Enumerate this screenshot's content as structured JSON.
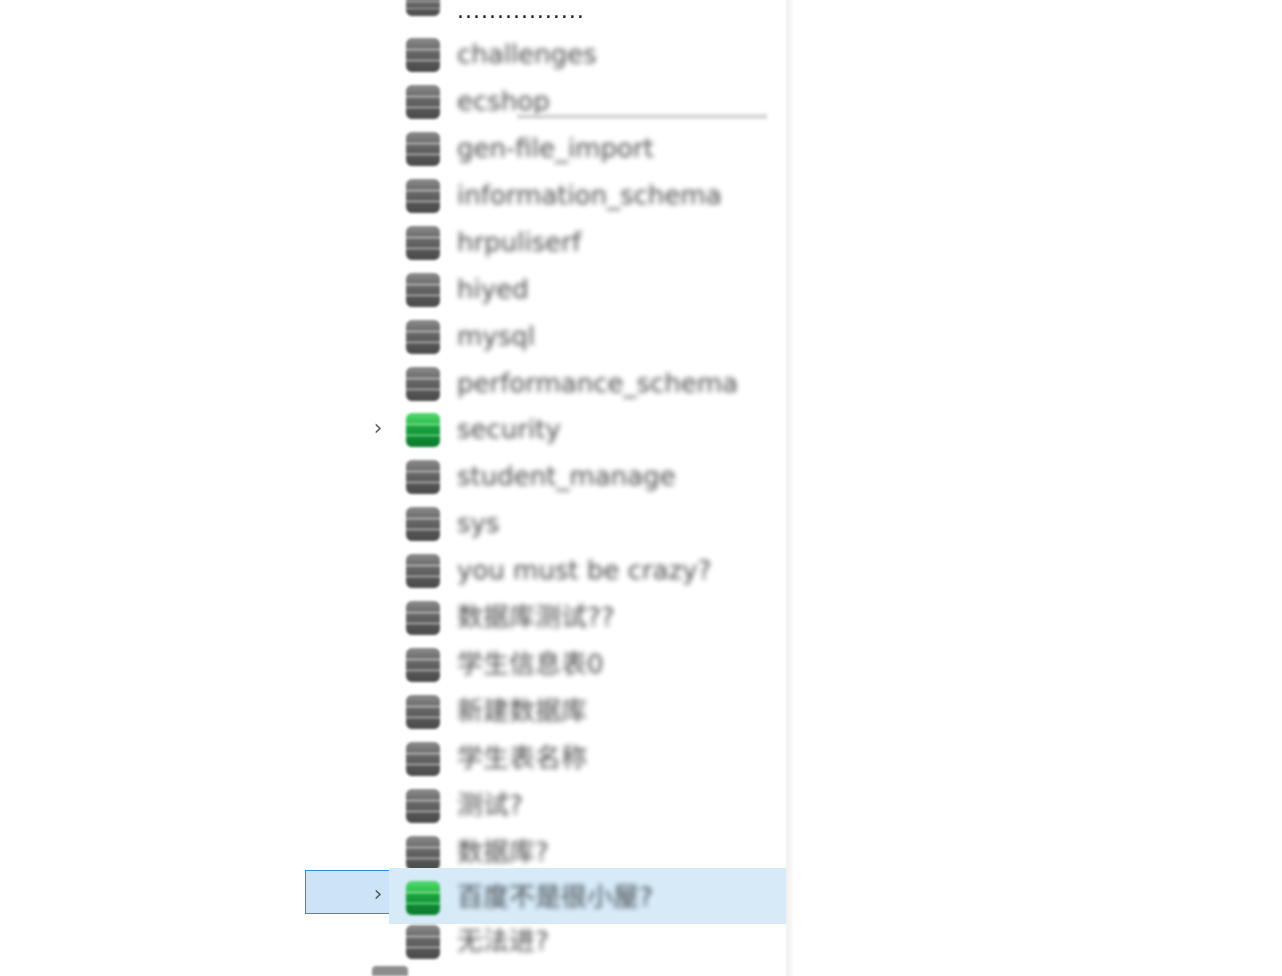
{
  "tree": {
    "items": [
      {
        "label": "................",
        "icon": "database-icon",
        "state": "closed",
        "expandable": false,
        "selected": false
      },
      {
        "label": "challenges",
        "icon": "database-icon",
        "state": "closed",
        "expandable": false,
        "selected": false
      },
      {
        "label": "ecshop",
        "icon": "database-icon",
        "state": "closed",
        "expandable": false,
        "selected": false
      },
      {
        "label": "gen-file_import",
        "icon": "database-icon",
        "state": "closed",
        "expandable": false,
        "selected": false
      },
      {
        "label": "information_schema",
        "icon": "database-icon",
        "state": "closed",
        "expandable": false,
        "selected": false
      },
      {
        "label": "hrpuliserf",
        "icon": "database-icon",
        "state": "closed",
        "expandable": false,
        "selected": false
      },
      {
        "label": "hiyed",
        "icon": "database-icon",
        "state": "closed",
        "expandable": false,
        "selected": false
      },
      {
        "label": "mysql",
        "icon": "database-icon",
        "state": "closed",
        "expandable": false,
        "selected": false
      },
      {
        "label": "performance_schema",
        "icon": "database-icon",
        "state": "closed",
        "expandable": false,
        "selected": false
      },
      {
        "label": "security",
        "icon": "database-icon",
        "state": "open",
        "expandable": true,
        "selected": false
      },
      {
        "label": "student_manage",
        "icon": "database-icon",
        "state": "closed",
        "expandable": false,
        "selected": false
      },
      {
        "label": "sys",
        "icon": "database-icon",
        "state": "closed",
        "expandable": false,
        "selected": false
      },
      {
        "label": "you must be crazy?",
        "icon": "database-icon",
        "state": "closed",
        "expandable": false,
        "selected": false
      },
      {
        "label": "数据库测试??",
        "icon": "database-icon",
        "state": "closed",
        "expandable": false,
        "selected": false
      },
      {
        "label": "学生信息表0",
        "icon": "database-icon",
        "state": "closed",
        "expandable": false,
        "selected": false
      },
      {
        "label": "新建数据库",
        "icon": "database-icon",
        "state": "closed",
        "expandable": false,
        "selected": false
      },
      {
        "label": "学生表名称",
        "icon": "database-icon",
        "state": "closed",
        "expandable": false,
        "selected": false
      },
      {
        "label": "测试?",
        "icon": "database-icon",
        "state": "closed",
        "expandable": false,
        "selected": false
      },
      {
        "label": "数据库?",
        "icon": "database-icon",
        "state": "closed",
        "expandable": false,
        "selected": false
      },
      {
        "label": "百度不是很小屋?",
        "icon": "database-icon",
        "state": "open",
        "expandable": true,
        "selected": true
      },
      {
        "label": "无法进?",
        "icon": "database-icon",
        "state": "closed",
        "expandable": false,
        "selected": false
      }
    ],
    "colors": {
      "closed_icon": "#5f5f5f",
      "open_icon": "#22b14c",
      "selection_fill": "#cce4f7",
      "selection_border": "#2f8ad8"
    },
    "expander_glyph": "›"
  }
}
